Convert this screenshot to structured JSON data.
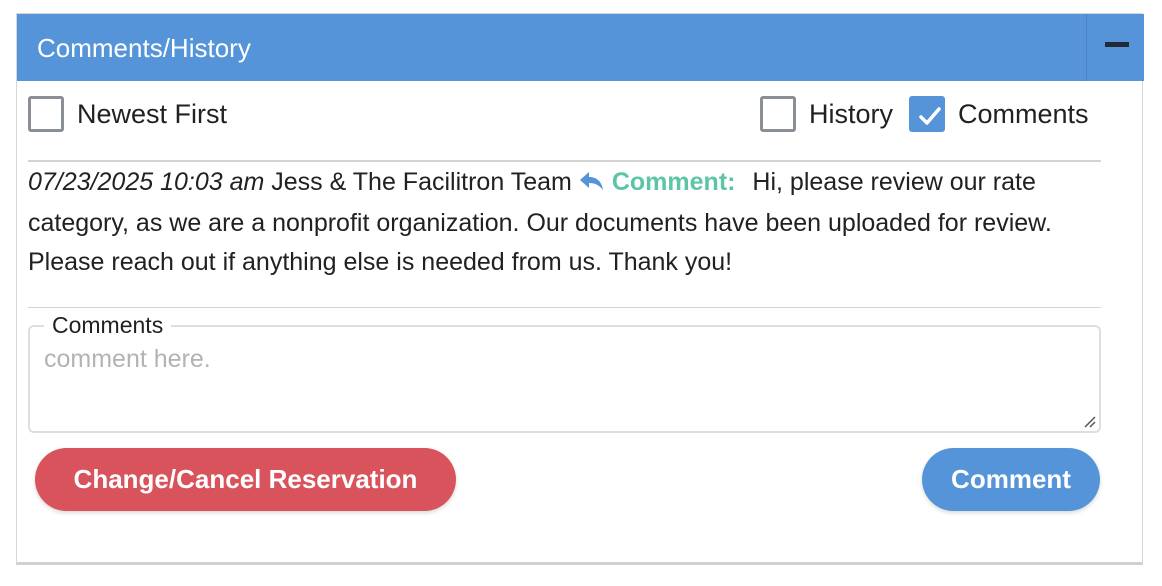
{
  "panel": {
    "title": "Comments/History",
    "collapse_icon": "minus-icon"
  },
  "options": {
    "newest_first": {
      "label": "Newest First",
      "checked": false
    },
    "history": {
      "label": "History",
      "checked": false
    },
    "comments": {
      "label": "Comments",
      "checked": true
    }
  },
  "entries": [
    {
      "timestamp": "07/23/2025 10:03 am",
      "author": "Jess & The Facilitron Team",
      "icon": "reply-icon",
      "tag": "Comment:",
      "text": "Hi, please review our rate category, as we are a nonprofit organization. Our documents have been uploaded for review. Please reach out if anything else is needed from us. Thank you!"
    }
  ],
  "comment_form": {
    "legend": "Comments",
    "value": "",
    "placeholder": "comment here."
  },
  "buttons": {
    "cancel_label": "Change/Cancel Reservation",
    "comment_label": "Comment"
  },
  "colors": {
    "header": "#5594d8",
    "tag": "#5cc4a8",
    "cancel": "#d9535c",
    "primary": "#5594d8"
  }
}
